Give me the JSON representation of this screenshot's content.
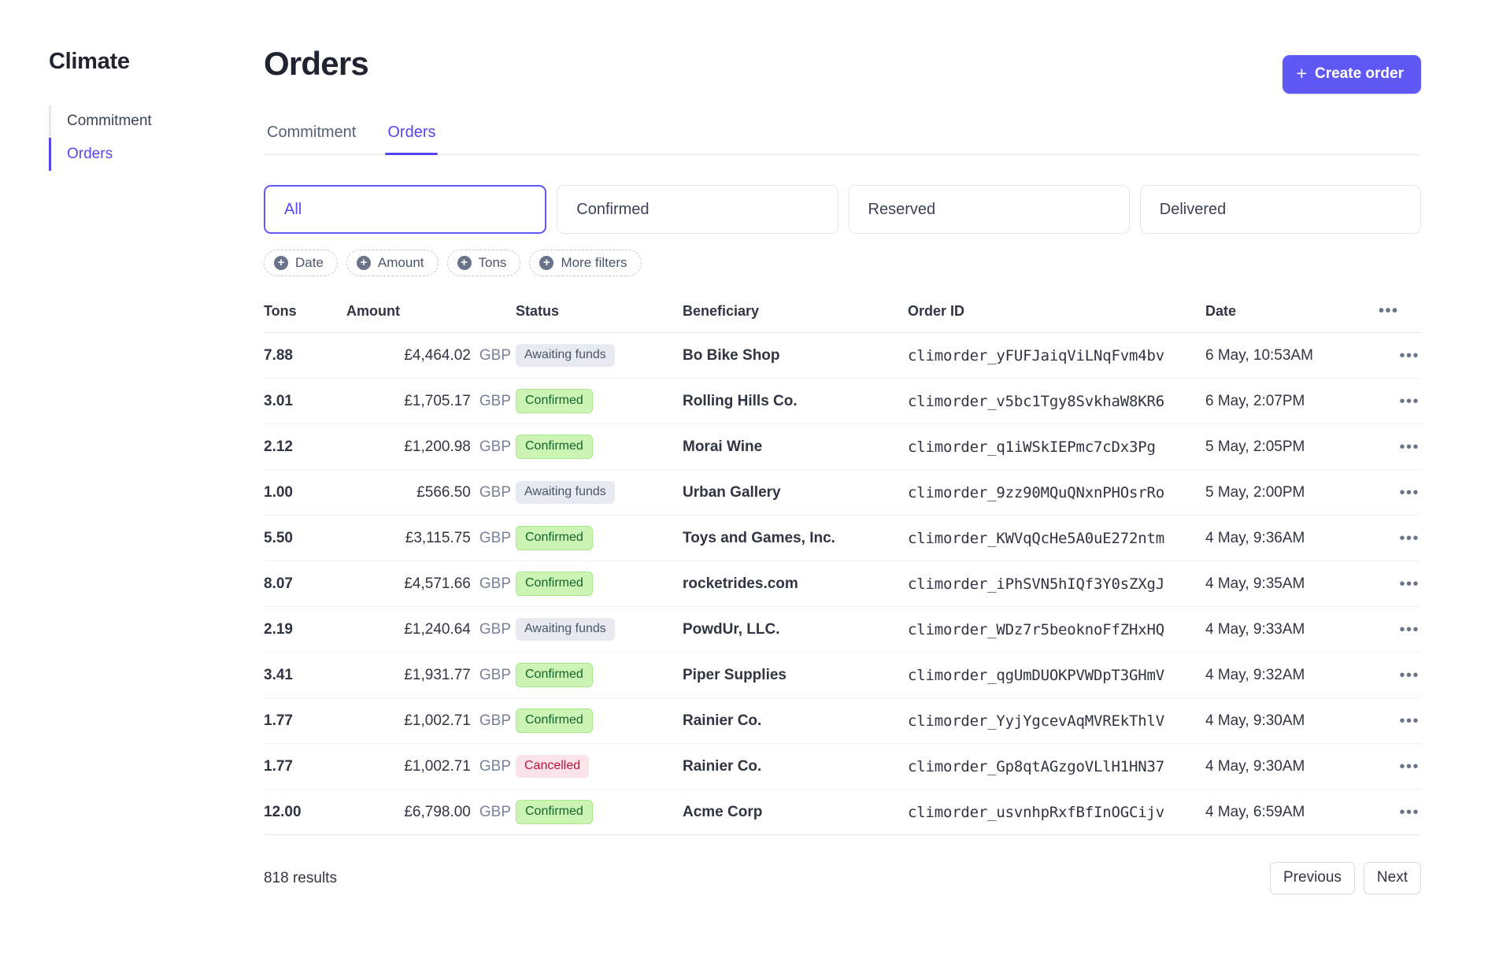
{
  "sidebar": {
    "brand": "Climate",
    "items": [
      {
        "label": "Commitment"
      },
      {
        "label": "Orders"
      }
    ]
  },
  "header": {
    "title": "Orders",
    "create_button": "Create order",
    "create_icon": "plus-icon"
  },
  "tabs": [
    {
      "label": "Commitment"
    },
    {
      "label": "Orders"
    }
  ],
  "segments": [
    {
      "label": "All"
    },
    {
      "label": "Confirmed"
    },
    {
      "label": "Reserved"
    },
    {
      "label": "Delivered"
    }
  ],
  "chips": [
    {
      "label": "Date",
      "icon": "plus-circle-icon"
    },
    {
      "label": "Amount",
      "icon": "plus-circle-icon"
    },
    {
      "label": "Tons",
      "icon": "plus-circle-icon"
    },
    {
      "label": "More filters",
      "icon": "plus-circle-icon"
    }
  ],
  "table": {
    "columns": [
      "Tons",
      "Amount",
      "Status",
      "Beneficiary",
      "Order ID",
      "Date"
    ],
    "overflow_icon": "ellipsis-icon",
    "rows": [
      {
        "tons": "7.88",
        "amount": "£4,464.02",
        "currency": "GBP",
        "status": "Awaiting funds",
        "status_kind": "neutral",
        "beneficiary": "Bo Bike Shop",
        "order_id": "climorder_yFUFJaiqViLNqFvm4bv",
        "date": "6 May, 10:53AM"
      },
      {
        "tons": "3.01",
        "amount": "£1,705.17",
        "currency": "GBP",
        "status": "Confirmed",
        "status_kind": "success",
        "beneficiary": "Rolling Hills Co.",
        "order_id": "climorder_v5bc1Tgy8SvkhaW8KR6",
        "date": "6 May, 2:07PM"
      },
      {
        "tons": "2.12",
        "amount": "£1,200.98",
        "currency": "GBP",
        "status": "Confirmed",
        "status_kind": "success",
        "beneficiary": "Morai Wine",
        "order_id": "climorder_q1iWSkIEPmc7cDx3Pg",
        "date": "5 May, 2:05PM"
      },
      {
        "tons": "1.00",
        "amount": "£566.50",
        "currency": "GBP",
        "status": "Awaiting funds",
        "status_kind": "neutral",
        "beneficiary": "Urban Gallery",
        "order_id": "climorder_9zz90MQuQNxnPHOsrRo",
        "date": "5 May, 2:00PM"
      },
      {
        "tons": "5.50",
        "amount": "£3,115.75",
        "currency": "GBP",
        "status": "Confirmed",
        "status_kind": "success",
        "beneficiary": "Toys and Games, Inc.",
        "order_id": "climorder_KWVqQcHe5A0uE272ntm",
        "date": "4 May, 9:36AM"
      },
      {
        "tons": "8.07",
        "amount": "£4,571.66",
        "currency": "GBP",
        "status": "Confirmed",
        "status_kind": "success",
        "beneficiary": "rocketrides.com",
        "order_id": "climorder_iPhSVN5hIQf3Y0sZXgJ",
        "date": "4 May, 9:35AM"
      },
      {
        "tons": "2.19",
        "amount": "£1,240.64",
        "currency": "GBP",
        "status": "Awaiting funds",
        "status_kind": "neutral",
        "beneficiary": "PowdUr, LLC.",
        "order_id": "climorder_WDz7r5beoknoFfZHxHQ",
        "date": "4 May, 9:33AM"
      },
      {
        "tons": "3.41",
        "amount": "£1,931.77",
        "currency": "GBP",
        "status": "Confirmed",
        "status_kind": "success",
        "beneficiary": "Piper Supplies",
        "order_id": "climorder_qgUmDUOKPVWDpT3GHmV",
        "date": "4 May, 9:32AM"
      },
      {
        "tons": "1.77",
        "amount": "£1,002.71",
        "currency": "GBP",
        "status": "Confirmed",
        "status_kind": "success",
        "beneficiary": "Rainier Co.",
        "order_id": "climorder_YyjYgcevAqMVREkThlV",
        "date": "4 May, 9:30AM"
      },
      {
        "tons": "1.77",
        "amount": "£1,002.71",
        "currency": "GBP",
        "status": "Cancelled",
        "status_kind": "error",
        "beneficiary": "Rainier Co.",
        "order_id": "climorder_Gp8qtAGzgoVLlH1HN37",
        "date": "4 May, 9:30AM"
      },
      {
        "tons": "12.00",
        "amount": "£6,798.00",
        "currency": "GBP",
        "status": "Confirmed",
        "status_kind": "success",
        "beneficiary": "Acme Corp",
        "order_id": "climorder_usvnhpRxfBfInOGCijv",
        "date": "4 May, 6:59AM"
      }
    ]
  },
  "footer": {
    "results": "818 results",
    "previous": "Previous",
    "next": "Next"
  },
  "colors": {
    "accent": "#5546f2",
    "accent_button": "#6058f5",
    "badge_success_bg": "#ccf5b5",
    "badge_success_text": "#13632a",
    "badge_neutral_bg": "#e7eaf0",
    "badge_error_bg": "#fbe3e9",
    "badge_error_text": "#c0123c"
  }
}
